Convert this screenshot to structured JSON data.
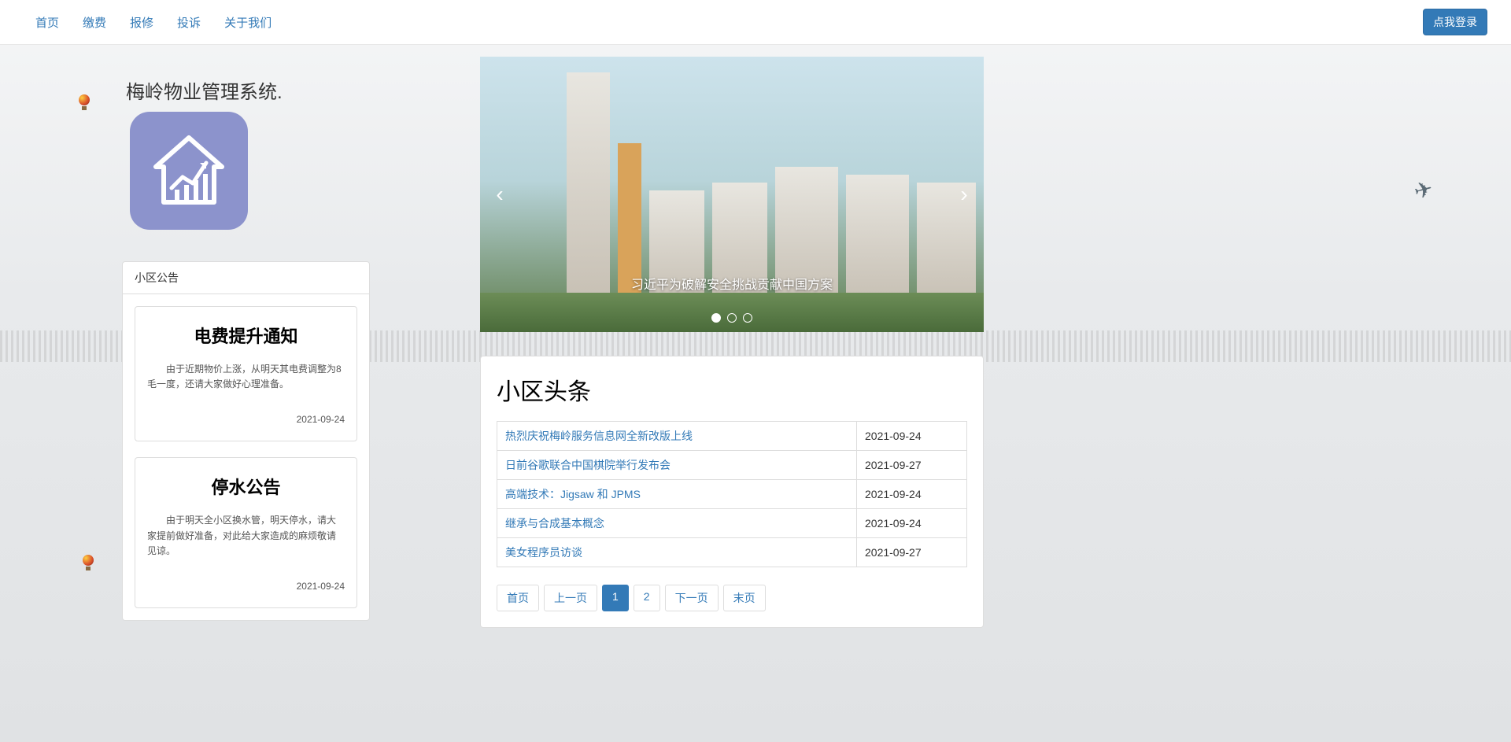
{
  "nav": {
    "items": [
      "首页",
      "缴费",
      "报修",
      "投诉",
      "关于我们"
    ],
    "login": "点我登录"
  },
  "site_title": "梅岭物业管理系统.",
  "notices": {
    "panel_title": "小区公告",
    "items": [
      {
        "title": "电费提升通知",
        "body": "由于近期物价上涨，从明天其电费调整为8毛一度，还请大家做好心理准备。",
        "date": "2021-09-24"
      },
      {
        "title": "停水公告",
        "body": "由于明天全小区换水管，明天停水，请大家提前做好准备，对此给大家造成的麻烦敬请见谅。",
        "date": "2021-09-24"
      }
    ]
  },
  "carousel": {
    "caption": "习近平为破解安全挑战贡献中国方案",
    "active_index": 0,
    "count": 3
  },
  "headlines": {
    "title": "小区头条",
    "rows": [
      {
        "title": "热烈庆祝梅岭服务信息网全新改版上线",
        "date": "2021-09-24"
      },
      {
        "title": "日前谷歌联合中国棋院举行发布会",
        "date": "2021-09-27"
      },
      {
        "title": "高端技术：Jigsaw 和 JPMS",
        "date": "2021-09-24"
      },
      {
        "title": "继承与合成基本概念",
        "date": "2021-09-24"
      },
      {
        "title": "美女程序员访谈",
        "date": "2021-09-27"
      }
    ],
    "pager": {
      "first": "首页",
      "prev": "上一页",
      "pages": [
        "1",
        "2"
      ],
      "current": "1",
      "next": "下一页",
      "last": "末页"
    }
  }
}
